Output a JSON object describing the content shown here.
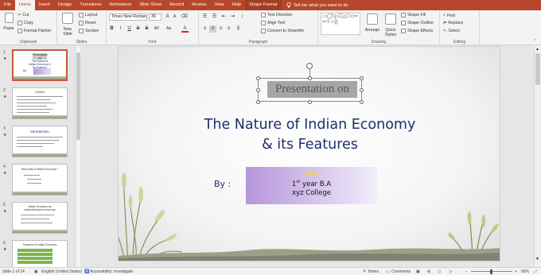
{
  "tabs": [
    "File",
    "Home",
    "Insert",
    "Design",
    "Transitions",
    "Animations",
    "Slide Show",
    "Record",
    "Review",
    "View",
    "Help",
    "Shape Format"
  ],
  "active_tab": "Home",
  "tell_me": "Tell me what you want to do",
  "ribbon": {
    "clipboard": {
      "paste": "Paste",
      "cut": "Cut",
      "copy": "Copy",
      "format_painter": "Format Painter",
      "label": "Clipboard"
    },
    "slides": {
      "new_slide": "New Slide",
      "layout": "Layout",
      "reset": "Reset",
      "section": "Section",
      "label": "Slides"
    },
    "font": {
      "name": "Times New Roman",
      "size": "36",
      "bold": "B",
      "italic": "I",
      "underline": "U",
      "strikethrough": "S",
      "shadow": "S",
      "spacing": "AV",
      "case": "Aa",
      "label": "Font"
    },
    "paragraph": {
      "text_direction": "Text Direction",
      "align_text": "Align Text",
      "smartart": "Convert to SmartArt",
      "label": "Paragraph"
    },
    "drawing": {
      "arrange": "Arrange",
      "quick_styles": "Quick Styles",
      "shape_fill": "Shape Fill",
      "shape_outline": "Shape Outline",
      "shape_effects": "Shape Effects",
      "shapes_gallery": "▭◯╲▷☐△⬠◇⇨⇦⇧☆{}",
      "label": "Drawing"
    },
    "editing": {
      "find": "Find",
      "replace": "Replace",
      "select": "Select",
      "label": "Editing"
    }
  },
  "thumbnails": [
    {
      "number": "1",
      "title": "Presentation on",
      "subtitle": "The Nature of Indian Economy & its Features",
      "by": "By :"
    },
    {
      "number": "2",
      "title": "Content"
    },
    {
      "number": "3",
      "title": "Introduction"
    },
    {
      "number": "4",
      "title": "Why India is Mixed Economy ?"
    },
    {
      "number": "5",
      "title": "Indian Economy as underdeveloped economy"
    },
    {
      "number": "6",
      "title": "Features of Indian Economy"
    }
  ],
  "slide": {
    "presentation_on": "Presentation on",
    "title_line1": "The Nature of Indian Economy",
    "title_line2": "& its Features",
    "by": "By :",
    "name": "xyz",
    "year_num": "1",
    "year_sup": "st",
    "year_rest": " year B.A",
    "college": "xyz College"
  },
  "status": {
    "slide_count": "Slide 1 of 14",
    "language": "English (United States)",
    "accessibility": "Accessibility: Investigate",
    "notes": "Notes",
    "comments": "Comments",
    "zoom": "85%"
  },
  "colors": {
    "accent": "#b7472a",
    "title": "#1f2f6b",
    "highlight": "#a6a6a6"
  }
}
